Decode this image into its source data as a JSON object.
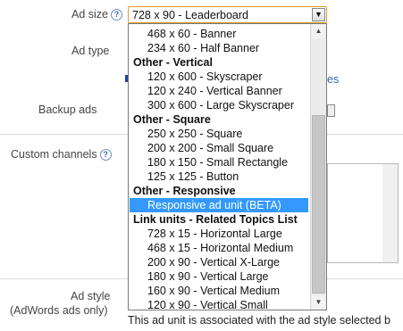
{
  "labels": {
    "ad_size": "Ad size",
    "ad_type": "Ad type",
    "backup_ads": "Backup ads",
    "custom_channels": "Custom channels",
    "ad_style": "Ad style",
    "ad_style_sub": "(AdWords ads only)"
  },
  "help_glyph": "?",
  "ad_size_select": {
    "value": "728 x 90 - Leaderboard",
    "arrow": "▼"
  },
  "dropdown": {
    "options": [
      {
        "label": "468 x 60 - Banner",
        "kind": "item"
      },
      {
        "label": "234 x 60 - Half Banner",
        "kind": "item"
      },
      {
        "label": "Other - Vertical",
        "kind": "group"
      },
      {
        "label": "120 x 600 - Skyscraper",
        "kind": "item"
      },
      {
        "label": "120 x 240 - Vertical Banner",
        "kind": "item"
      },
      {
        "label": "300 x 600 - Large Skyscraper",
        "kind": "item"
      },
      {
        "label": "Other - Square",
        "kind": "group"
      },
      {
        "label": "250 x 250 - Square",
        "kind": "item"
      },
      {
        "label": "200 x 200 - Small Square",
        "kind": "item"
      },
      {
        "label": "180 x 150 - Small Rectangle",
        "kind": "item"
      },
      {
        "label": "125 x 125 - Button",
        "kind": "item"
      },
      {
        "label": "Other - Responsive",
        "kind": "group"
      },
      {
        "label": "Responsive ad unit (BETA)",
        "kind": "item",
        "selected": true
      },
      {
        "label": "Link units - Related Topics List",
        "kind": "group"
      },
      {
        "label": "728 x 15 - Horizontal Large",
        "kind": "item"
      },
      {
        "label": "468 x 15 - Horizontal Medium",
        "kind": "item"
      },
      {
        "label": "200 x 90 - Vertical X-Large",
        "kind": "item"
      },
      {
        "label": "180 x 90 - Vertical Large",
        "kind": "item"
      },
      {
        "label": "160 x 90 - Vertical Medium",
        "kind": "item"
      },
      {
        "label": "120 x 90 - Vertical Small",
        "kind": "item"
      }
    ],
    "scroll_up": "▲",
    "scroll_down": "▼"
  },
  "background": {
    "ad_type_link_fragment": "es",
    "footnote": "This ad unit is associated with the ad style selected b"
  },
  "colors": {
    "select_border": "#e39a1f",
    "selected_option_bg": "#3399ff",
    "help_icon": "#3a66b0"
  }
}
